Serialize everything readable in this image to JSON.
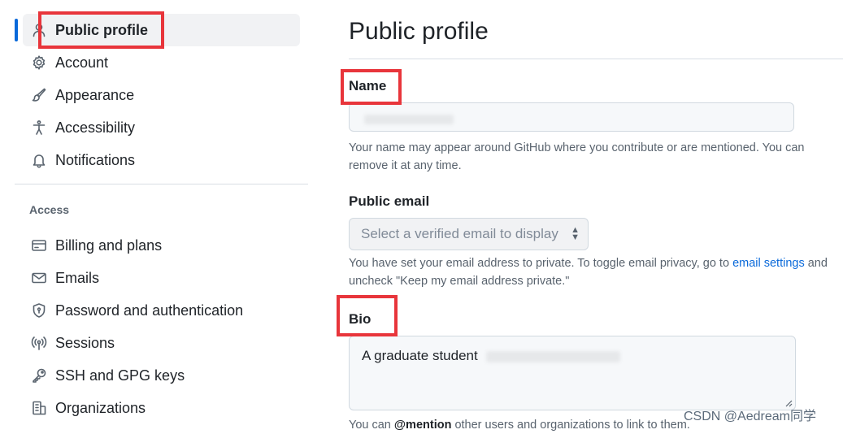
{
  "sidebar": {
    "items": [
      {
        "label": "Public profile",
        "icon": "person-icon"
      },
      {
        "label": "Account",
        "icon": "gear-icon"
      },
      {
        "label": "Appearance",
        "icon": "paintbrush-icon"
      },
      {
        "label": "Accessibility",
        "icon": "accessibility-icon"
      },
      {
        "label": "Notifications",
        "icon": "bell-icon"
      }
    ],
    "access_heading": "Access",
    "access_items": [
      {
        "label": "Billing and plans",
        "icon": "credit-card-icon"
      },
      {
        "label": "Emails",
        "icon": "mail-icon"
      },
      {
        "label": "Password and authentication",
        "icon": "shield-lock-icon"
      },
      {
        "label": "Sessions",
        "icon": "broadcast-icon"
      },
      {
        "label": "SSH and GPG keys",
        "icon": "key-icon"
      },
      {
        "label": "Organizations",
        "icon": "organization-icon"
      }
    ]
  },
  "main": {
    "title": "Public profile",
    "name": {
      "label": "Name",
      "help": "Your name may appear around GitHub where you contribute or are mentioned. You can remove it at any time."
    },
    "public_email": {
      "label": "Public email",
      "select_value": "Select a verified email to display",
      "help_before": "You have set your email address to private. To toggle email privacy, go to ",
      "help_link": "email settings",
      "help_after": " and uncheck \"Keep my email address private.\""
    },
    "bio": {
      "label": "Bio",
      "value": "A graduate student",
      "help_before": "You can ",
      "help_mention": "@mention",
      "help_after": " other users and organizations to link to them."
    }
  },
  "watermark": "CSDN @Aedream同学",
  "colors": {
    "accent": "#0969da",
    "highlight": "#e8353b",
    "text": "#1f2328",
    "muted": "#59636e"
  }
}
